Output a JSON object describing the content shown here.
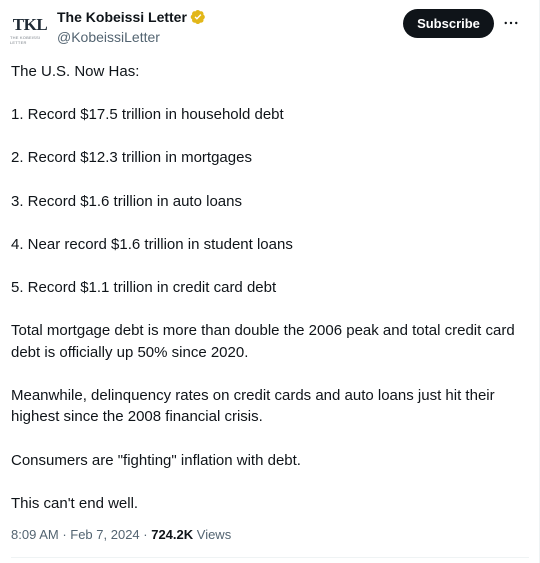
{
  "author": {
    "avatar_text": "KL",
    "avatar_prefix": "T",
    "avatar_tagline": "THE KOBEISSI LETTER",
    "name": "The Kobeissi Letter",
    "handle": "@KobeissiLetter",
    "verified_color": "#e2b719"
  },
  "actions": {
    "subscribe_label": "Subscribe",
    "more_icon": "more-horizontal-icon"
  },
  "tweet": {
    "paragraphs": [
      "The U.S. Now Has:",
      "1. Record $17.5 trillion in household debt",
      "2. Record $12.3 trillion in mortgages",
      "3. Record $1.6 trillion in auto loans",
      "4. Near record $1.6 trillion in student loans",
      "5. Record $1.1 trillion in credit card debt",
      "Total mortgage debt is more than double the 2006 peak and total credit card debt is officially up 50% since 2020.",
      "Meanwhile, delinquency rates on credit cards and auto loans just hit their highest since the 2008 financial crisis.",
      "Consumers are \"fighting\" inflation with debt.",
      "This can't end well."
    ]
  },
  "meta": {
    "time": "8:09 AM",
    "separator": " · ",
    "date": "Feb 7, 2024",
    "views_count": "724.2K",
    "views_label": " Views"
  }
}
